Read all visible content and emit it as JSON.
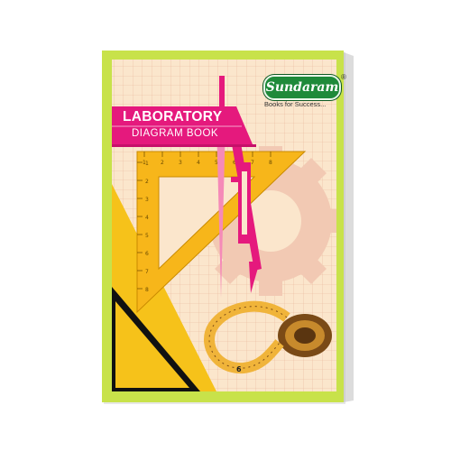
{
  "cover": {
    "title_line1": "LABORATORY",
    "title_line2": "DIAGRAM BOOK",
    "brand_name": "Sundaram",
    "brand_mark": "®",
    "tagline": "Books for Success...",
    "ruler_numbers_top": [
      "1",
      "2",
      "3",
      "4",
      "5",
      "6",
      "7",
      "8"
    ],
    "ruler_numbers_side": [
      "1",
      "2",
      "3",
      "4",
      "5",
      "6",
      "7",
      "8"
    ],
    "tape_number": "6"
  },
  "colors": {
    "lime_border": "#c8e24a",
    "paper": "#fbe6cc",
    "grid": "#e9b79a",
    "magenta": "#e5197d",
    "yellow": "#f6c21a",
    "brand_green": "#1f8a3a",
    "gear": "#f2c9b3"
  },
  "icons": [
    "compass-icon",
    "set-square-icon",
    "gear-icon",
    "measuring-tape-icon"
  ]
}
